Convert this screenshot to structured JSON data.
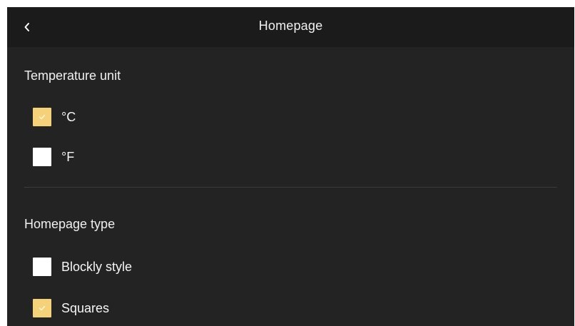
{
  "header": {
    "back_icon": "chevron-left-icon",
    "title": "Homepage"
  },
  "temperature_unit": {
    "title": "Temperature unit",
    "options": [
      {
        "label": "°C",
        "checked": true
      },
      {
        "label": "°F",
        "checked": false
      }
    ]
  },
  "homepage_type": {
    "title": "Homepage type",
    "options": [
      {
        "label": "Blockly style",
        "checked": false
      },
      {
        "label": "Squares",
        "checked": true
      }
    ]
  },
  "colors": {
    "background": "#232323",
    "header_background": "#1b1b1b",
    "checked_accent": "#f5d27a",
    "unchecked_box": "#ffffff",
    "text": "#f0f0f0"
  }
}
